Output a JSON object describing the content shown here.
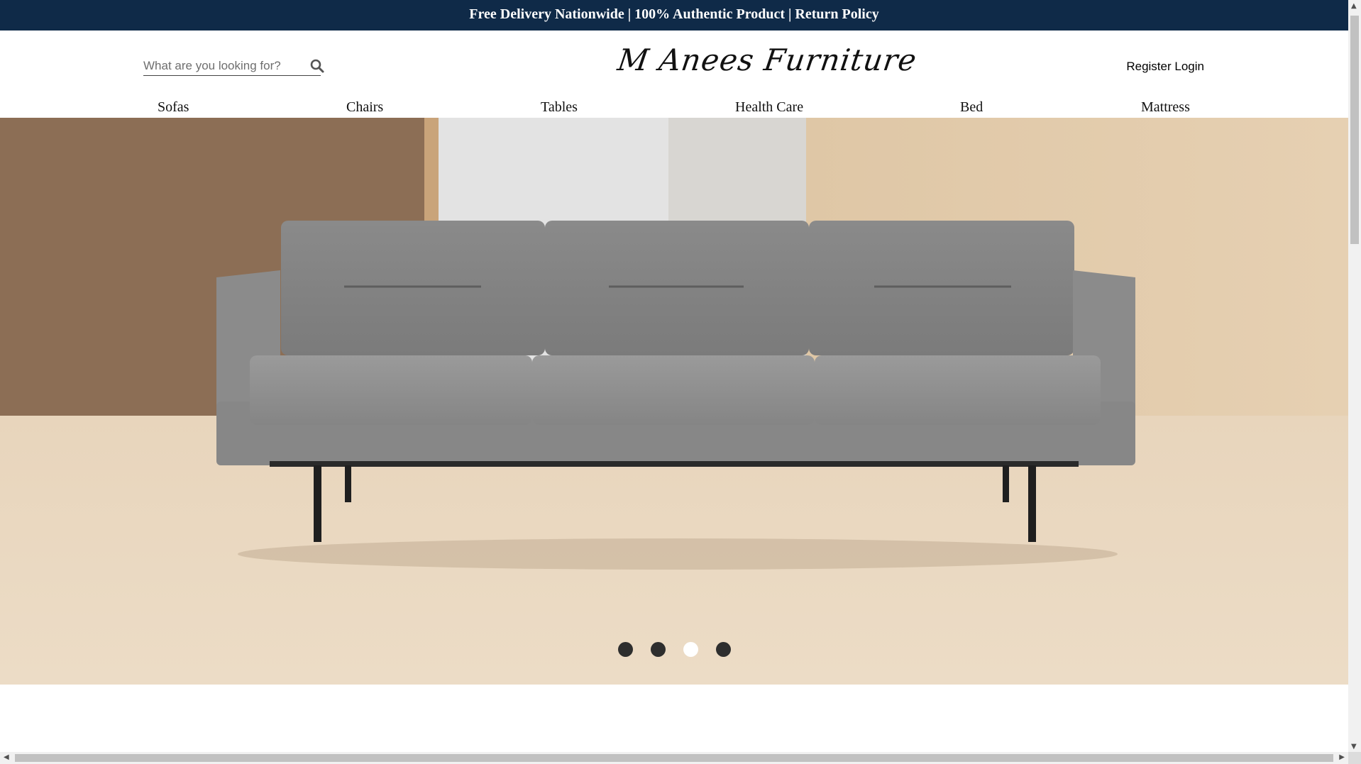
{
  "announcement": "Free Delivery Nationwide | 100% Authentic Product | Return Policy",
  "search": {
    "placeholder": "What are you looking for?"
  },
  "logo": "M Anees Furniture",
  "auth": {
    "register": "Register",
    "login": "Login"
  },
  "nav": [
    "Sofas",
    "Chairs",
    "Tables",
    "Health Care",
    "Bed",
    "Mattress"
  ],
  "carousel": {
    "slides": 4,
    "active_index": 2
  },
  "colors": {
    "topbar": "#0f2a48",
    "sofa": "#7a7a7a",
    "floor": "#e6d2b8"
  },
  "icons": {
    "search": "search-icon"
  }
}
